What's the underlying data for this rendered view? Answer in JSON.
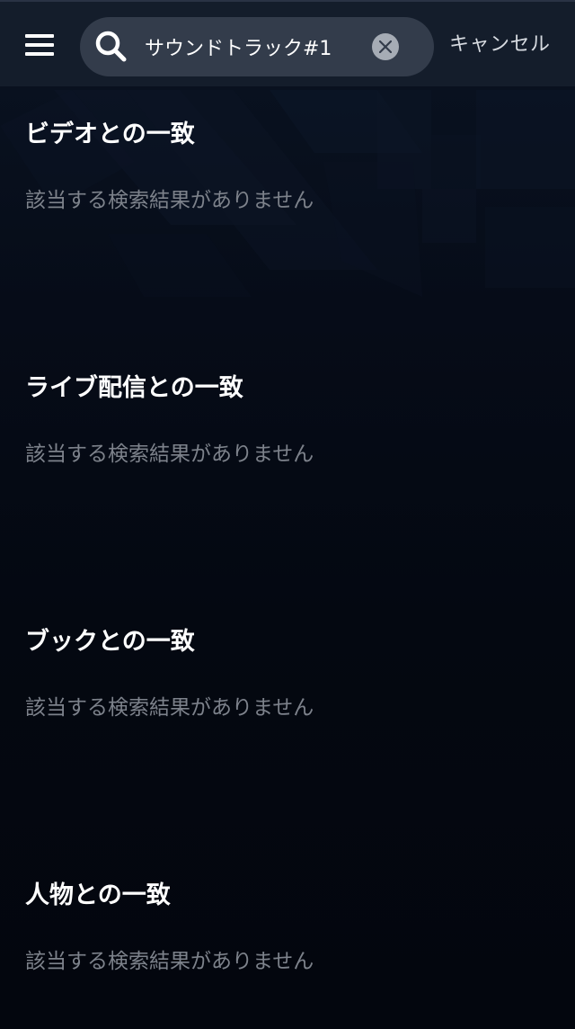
{
  "header": {
    "menu_icon": "hamburger-menu-icon",
    "search": {
      "icon": "search-icon",
      "value": "サウンドトラック#1",
      "clear_icon": "close-icon"
    },
    "cancel_label": "キャンセル"
  },
  "sections": [
    {
      "title": "ビデオとの一致",
      "empty_text": "該当する検索結果がありません"
    },
    {
      "title": "ライブ配信との一致",
      "empty_text": "該当する検索結果がありません"
    },
    {
      "title": "ブックとの一致",
      "empty_text": "該当する検索結果がありません"
    },
    {
      "title": "人物との一致",
      "empty_text": "該当する検索結果がありません"
    }
  ],
  "colors": {
    "background": "#040811",
    "header": "#161e2c",
    "search_box": "#333c4b",
    "title_text": "#ffffff",
    "empty_text": "#7d828b",
    "cancel_text": "#d6dae0"
  }
}
